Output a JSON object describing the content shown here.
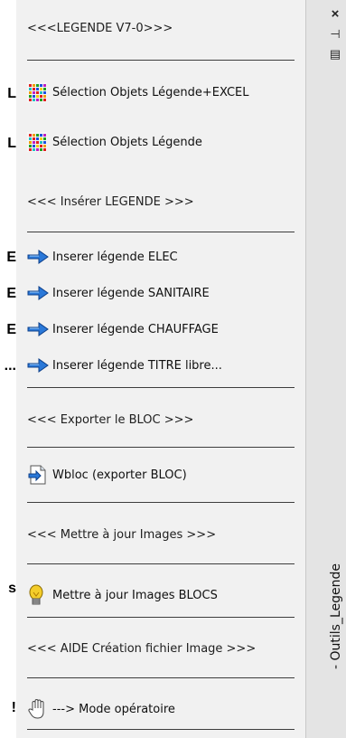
{
  "left_edge_chars": [
    "L",
    "L",
    "E",
    "E",
    "E",
    "...",
    "s",
    "!"
  ],
  "palette": {
    "sections": {
      "legende_header": "<<<LEGENDE V7-0>>>",
      "inserer_header": "<<< Insérer LEGENDE >>>",
      "exporter_header": "<<< Exporter le BLOC >>>",
      "images_header": "<<< Mettre à jour Images >>>",
      "aide_header": "<<< AIDE Création fichier Image >>>"
    },
    "tools": {
      "selection_excel": "Sélection Objets Légende+EXCEL",
      "selection": "Sélection Objets Légende",
      "inserer_elec": "Inserer légende ELEC",
      "inserer_sanitaire": "Inserer légende SANITAIRE",
      "inserer_chauffage": "Inserer légende CHAUFFAGE",
      "inserer_titre": "Inserer légende TITRE libre...",
      "wbloc": "Wbloc (exporter BLOC)",
      "maj_images": "Mettre à jour Images BLOCS",
      "mode_operatoire": "---> Mode opératoire"
    },
    "icons": {
      "selection": "colored-grid-icon",
      "inserer": "blue-arrow-icon",
      "wbloc": "export-file-icon",
      "maj_images": "lightbulb-icon",
      "mode_operatoire": "hand-icon"
    }
  },
  "titlebar": {
    "close_symbol": "×",
    "autohide_symbol": "⊣",
    "properties_symbol": "▤",
    "title": "- Outils_Legende"
  }
}
